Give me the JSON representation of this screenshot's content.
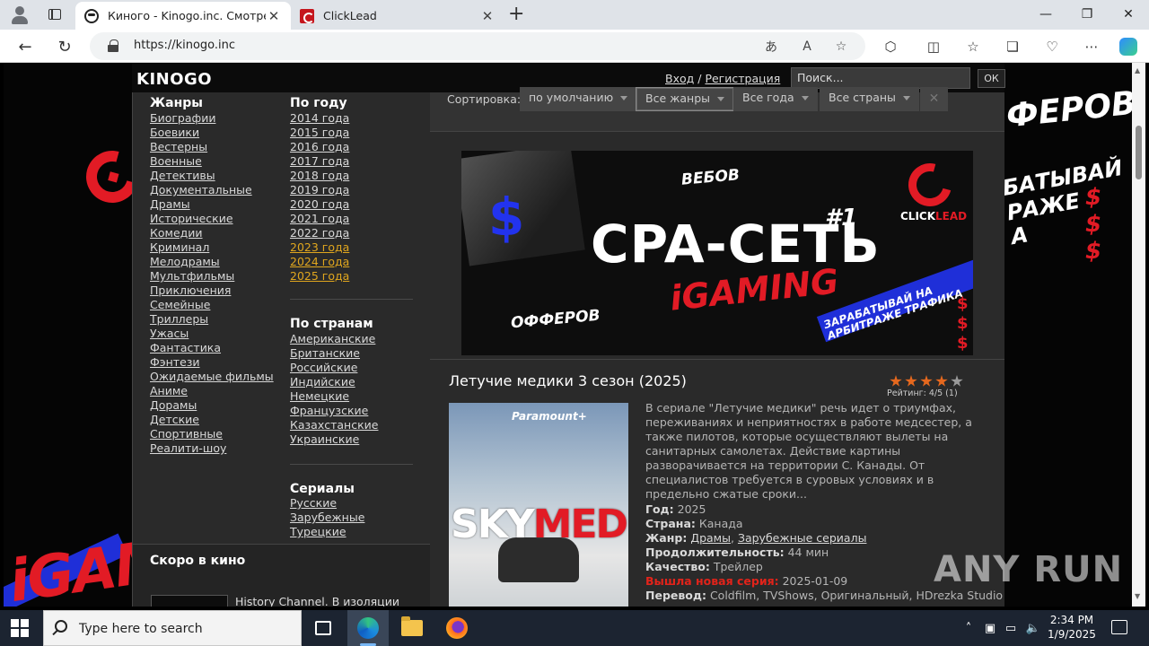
{
  "browser": {
    "tabs": [
      {
        "title": "Киного - Kinogo.inc. Смотреть ф",
        "active": true
      },
      {
        "title": "ClickLead",
        "active": false
      }
    ],
    "url": "https://kinogo.inc"
  },
  "site": {
    "logo": "KINOGO",
    "login": "Вход",
    "separator": "/",
    "register": "Регистрация",
    "search_placeholder": "Поиск...",
    "search_button": "ОК"
  },
  "nav": {
    "genres_title": "Жанры",
    "genres": [
      "Биографии",
      "Боевики",
      "Вестерны",
      "Военные",
      "Детективы",
      "Документальные",
      "Драмы",
      "Исторические",
      "Комедии",
      "Криминал",
      "Мелодрамы",
      "Мультфильмы",
      "Приключения",
      "Семейные",
      "Триллеры",
      "Ужасы",
      "Фантастика",
      "Фэнтези",
      "Ожидаемые фильмы",
      "Аниме",
      "Дорамы",
      "Детские",
      "Спортивные",
      "Реалити-шоу"
    ],
    "years_title": "По году",
    "years": [
      "2014 года",
      "2015 года",
      "2016 года",
      "2017 года",
      "2018 года",
      "2019 года",
      "2020 года",
      "2021 года",
      "2022 года",
      "2023 года",
      "2024 года",
      "2025 года"
    ],
    "countries_title": "По странам",
    "countries": [
      "Американские",
      "Британские",
      "Российские",
      "Индийские",
      "Немецкие",
      "Французские",
      "Казахстанские",
      "Украинские"
    ],
    "series_title": "Сериалы",
    "series": [
      "Русские",
      "Зарубежные",
      "Турецкие"
    ],
    "soon_title": "Скоро в кино",
    "soon_item": "History Channel. В изоляции"
  },
  "sortbar": {
    "label": "Сортировка:",
    "filters": [
      "по умолчанию",
      "Все жанры",
      "Все года",
      "Все страны"
    ],
    "clear": "✕"
  },
  "banner": {
    "main": "CPA-СЕТЬ",
    "number": "#1",
    "sub": "iGAMING",
    "webs": "ВЕБОВ",
    "offers": "ОФФЕРОВ",
    "earn": "ЗАРАБАТЫВАЙ НА АРБИТРАЖЕ ТРАФИКА",
    "brand": "CLICK",
    "brand_accent": "LEAD"
  },
  "movie": {
    "title": "Летучие медики 3 сезон (2025)",
    "rating_text": "Рейтинг: 4/5 (1)",
    "rating": 4,
    "rating_max": 5,
    "poster_brand": "Paramount+",
    "poster_title_a": "SKY",
    "poster_title_b": "MED",
    "description": "В сериале \"Летучие медики\" речь идет о триумфах, переживаниях и неприятностях в работе медсестер, а также пилотов, которые осуществляют вылеты на санитарных самолетах. Действие картины разворачивается на территории С. Канады. От специалистов требуется в суровых условиях и в предельно сжатые сроки...",
    "year_label": "Год:",
    "year": "2025",
    "country_label": "Страна:",
    "country": "Канада",
    "genre_label": "Жанр:",
    "genre_1": "Драмы",
    "genre_2": "Зарубежные сериалы",
    "duration_label": "Продолжительность:",
    "duration": "44 мин",
    "quality_label": "Качество:",
    "quality": "Трейлер",
    "new_ep_label": "Вышла новая серия:",
    "new_ep_date": "2025-01-09",
    "translation_label": "Перевод:",
    "translation": "Coldfilm, TVShows, Оригинальный, HDrezka Studio"
  },
  "watermark": "ANY RUN",
  "side_banner": {
    "right_top": "ФЕРОВ",
    "right_mid": "БАТЫВАЙ\nРАЖЕ\nА",
    "left_bottom": "iGAM"
  },
  "taskbar": {
    "search_placeholder": "Type here to search",
    "time": "2:34 PM",
    "date": "1/9/2025"
  },
  "colors": {
    "accent_red": "#e21b25",
    "year_highlight": "#e0a61e",
    "panel_bg": "#2a2a2a"
  }
}
